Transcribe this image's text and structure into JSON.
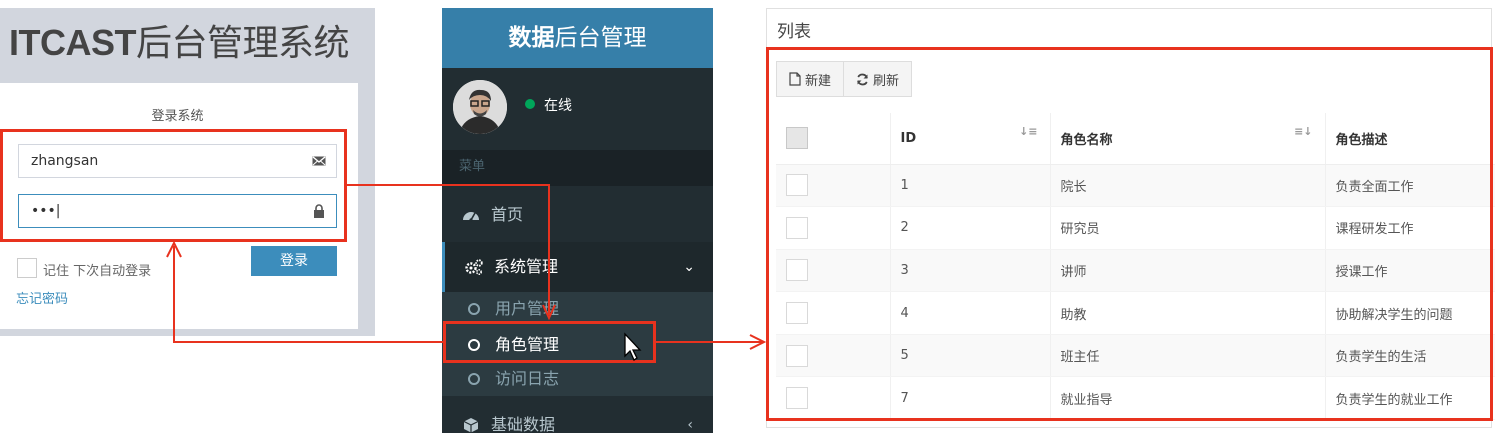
{
  "login": {
    "title_bold": "ITCAST",
    "title_rest": "后台管理系统",
    "box_msg": "登录系统",
    "username_value": "zhangsan",
    "password_value": "•••|",
    "remember_label": "记住 下次自动登录",
    "login_button": "登录",
    "forgot_link": "忘记密码"
  },
  "sidebar": {
    "header_bold": "数据",
    "header_rest": "后台管理",
    "status_text": "在线",
    "menu_header": "菜单",
    "items": [
      {
        "label": "首页",
        "icon": "dashboard-icon"
      },
      {
        "label": "系统管理",
        "icon": "cogs-icon"
      },
      {
        "label": "基础数据",
        "icon": "cube-icon"
      }
    ],
    "submenu": [
      "用户管理",
      "角色管理",
      "访问日志"
    ]
  },
  "list": {
    "title": "列表",
    "toolbar": {
      "new_label": "新建",
      "refresh_label": "刷新"
    },
    "columns": [
      "ID",
      "角色名称",
      "角色描述"
    ],
    "rows": [
      {
        "id": "1",
        "name": "院长",
        "desc": "负责全面工作"
      },
      {
        "id": "2",
        "name": "研究员",
        "desc": "课程研发工作"
      },
      {
        "id": "3",
        "name": "讲师",
        "desc": "授课工作"
      },
      {
        "id": "4",
        "name": "助教",
        "desc": "协助解决学生的问题"
      },
      {
        "id": "5",
        "name": "班主任",
        "desc": "负责学生的生活"
      },
      {
        "id": "7",
        "name": "就业指导",
        "desc": "负责学生的就业工作"
      }
    ]
  },
  "colors": {
    "accent": "#3c8dbc",
    "sidebar_bg": "#222d32",
    "annotation": "#e8321e",
    "online": "#00a65a"
  }
}
